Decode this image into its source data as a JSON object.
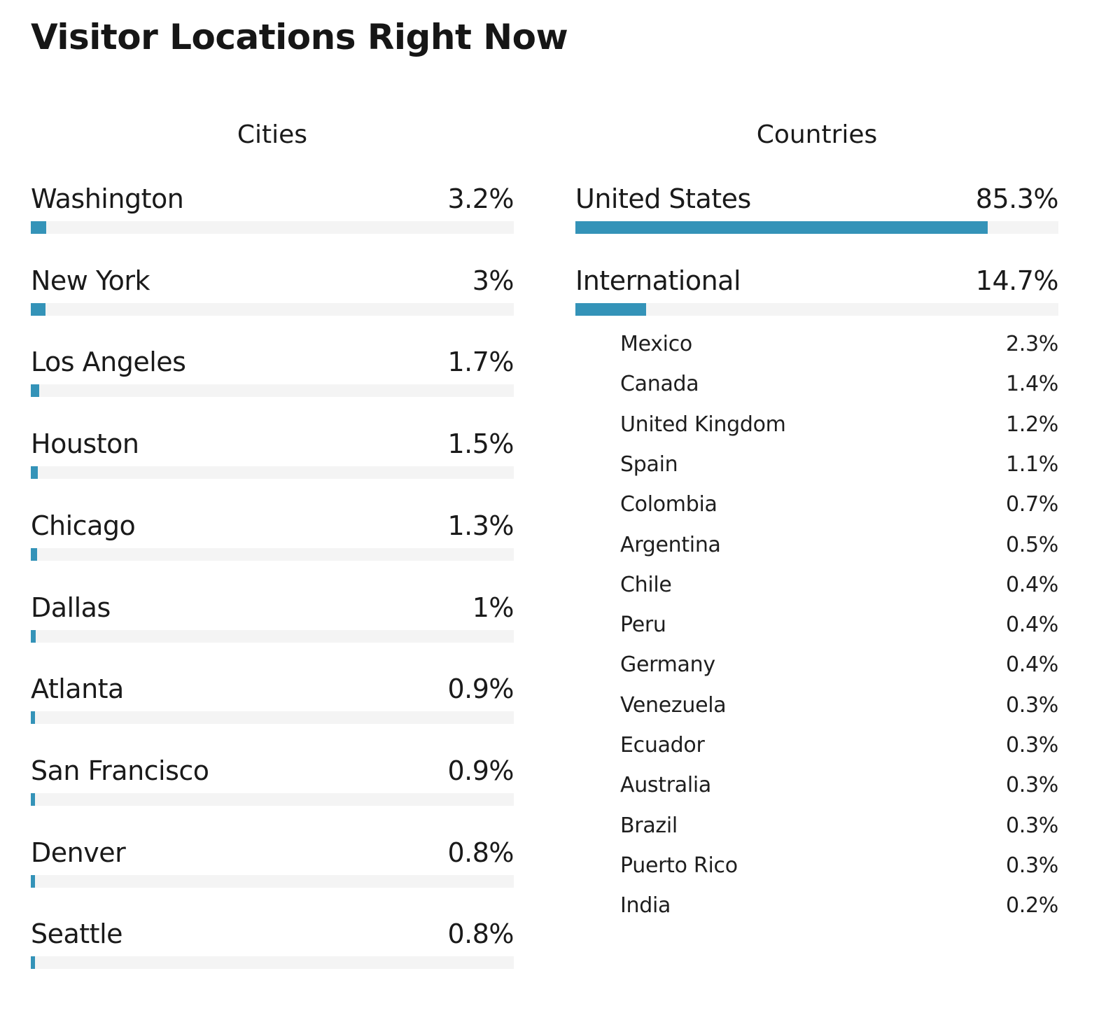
{
  "title": "Visitor Locations Right Now",
  "colors": {
    "bar": "#3493b8",
    "track": "#f4f4f4"
  },
  "chart_data": [
    {
      "type": "bar",
      "orientation": "horizontal",
      "title": "Cities",
      "categories": [
        "Washington",
        "New York",
        "Los Angeles",
        "Houston",
        "Chicago",
        "Dallas",
        "Atlanta",
        "San Francisco",
        "Denver",
        "Seattle"
      ],
      "values": [
        3.2,
        3,
        1.7,
        1.5,
        1.3,
        1,
        0.9,
        0.9,
        0.8,
        0.8
      ],
      "labels": [
        "3.2%",
        "3%",
        "1.7%",
        "1.5%",
        "1.3%",
        "1%",
        "0.9%",
        "0.9%",
        "0.8%",
        "0.8%"
      ],
      "unit": "%",
      "xlim": [
        0,
        100
      ]
    },
    {
      "type": "bar",
      "orientation": "horizontal",
      "title": "Countries",
      "categories": [
        "United States",
        "International"
      ],
      "values": [
        85.3,
        14.7
      ],
      "labels": [
        "85.3%",
        "14.7%"
      ],
      "unit": "%",
      "xlim": [
        0,
        100
      ],
      "breakdown": {
        "parent": "International",
        "type": "table",
        "categories": [
          "Mexico",
          "Canada",
          "United Kingdom",
          "Spain",
          "Colombia",
          "Argentina",
          "Chile",
          "Peru",
          "Germany",
          "Venezuela",
          "Ecuador",
          "Australia",
          "Brazil",
          "Puerto Rico",
          "India"
        ],
        "values": [
          2.3,
          1.4,
          1.2,
          1.1,
          0.7,
          0.5,
          0.4,
          0.4,
          0.4,
          0.3,
          0.3,
          0.3,
          0.3,
          0.3,
          0.2
        ],
        "labels": [
          "2.3%",
          "1.4%",
          "1.2%",
          "1.1%",
          "0.7%",
          "0.5%",
          "0.4%",
          "0.4%",
          "0.4%",
          "0.3%",
          "0.3%",
          "0.3%",
          "0.3%",
          "0.3%",
          "0.2%"
        ]
      }
    }
  ]
}
